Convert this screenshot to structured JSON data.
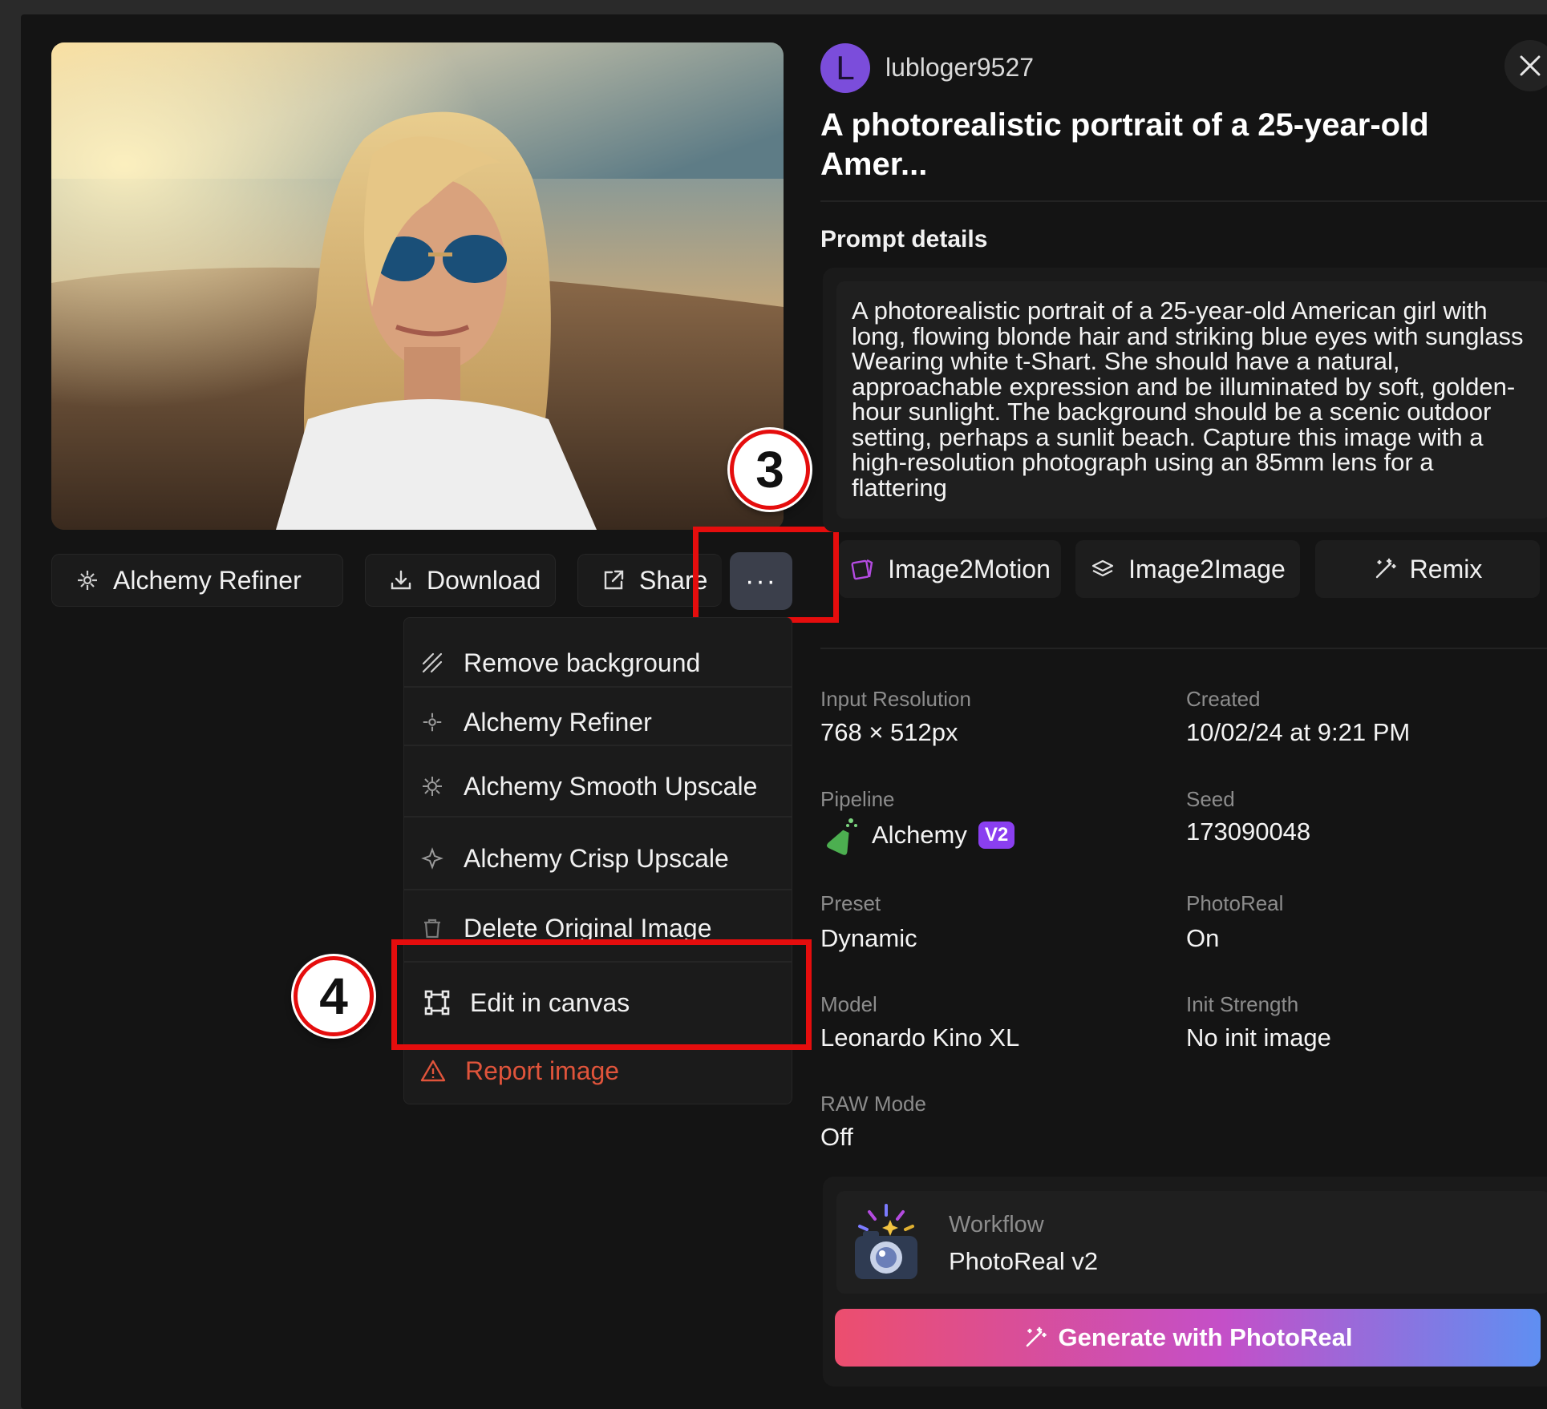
{
  "toolbar": {
    "alchemy_refiner": "Alchemy Refiner",
    "download": "Download",
    "share": "Share",
    "more": "···"
  },
  "annotations": {
    "step3": "3",
    "step4": "4"
  },
  "menu": {
    "items": [
      "Remove background",
      "Alchemy Refiner",
      "Alchemy Smooth Upscale",
      "Alchemy Crisp Upscale",
      "Delete Original Image",
      "Edit in canvas",
      "Report image"
    ]
  },
  "user": {
    "avatar_letter": "L",
    "name": "lubloger9527"
  },
  "title": "A photorealistic portrait of a 25-year-old Amer...",
  "prompt": {
    "label": "Prompt details",
    "text": "A photorealistic portrait of a 25-year-old American girl with long, flowing blonde hair and striking blue eyes with sunglass Wearing white t-Shart. She should have a natural, approachable expression and be illuminated by soft, golden-hour sunlight. The background should be a scenic outdoor setting, perhaps a sunlit beach. Capture this image with a high-resolution photograph using an 85mm lens for a flattering"
  },
  "actions": {
    "image2motion": "Image2Motion",
    "image2image": "Image2Image",
    "remix": "Remix"
  },
  "details": {
    "input_resolution": {
      "label": "Input Resolution",
      "value": "768 × 512px"
    },
    "created": {
      "label": "Created",
      "value": "10/02/24 at 9:21 PM"
    },
    "pipeline": {
      "label": "Pipeline",
      "value": "Alchemy",
      "badge": "V2"
    },
    "seed": {
      "label": "Seed",
      "value": "173090048"
    },
    "preset": {
      "label": "Preset",
      "value": "Dynamic"
    },
    "photoreal": {
      "label": "PhotoReal",
      "value": "On"
    },
    "model": {
      "label": "Model",
      "value": "Leonardo Kino XL"
    },
    "init_strength": {
      "label": "Init Strength",
      "value": "No init image"
    },
    "raw_mode": {
      "label": "RAW Mode",
      "value": "Off"
    }
  },
  "workflow": {
    "label": "Workflow",
    "value": "PhotoReal v2"
  },
  "generate_button": "Generate with PhotoReal",
  "colors": {
    "highlight": "#e50d0d",
    "report": "#e0543b",
    "badge": "#8a3ff0",
    "avatar": "#7b4ddb"
  }
}
